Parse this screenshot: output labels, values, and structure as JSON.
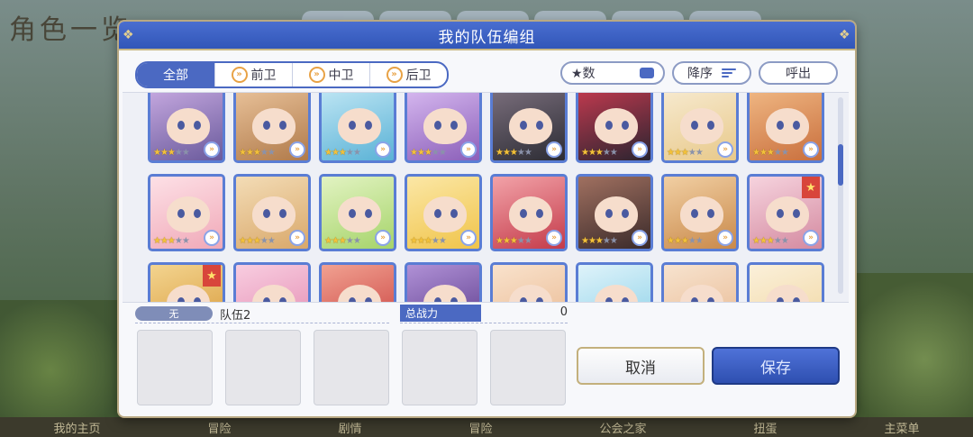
{
  "background": {
    "title": "角色一览",
    "nav": [
      "我的主页",
      "冒险",
      "剧情",
      "冒险",
      "公会之家",
      "扭蛋",
      "主菜单"
    ]
  },
  "dialog": {
    "title": "我的队伍编组",
    "filters": {
      "tabs": [
        {
          "label": "全部",
          "icon": "",
          "active": true
        },
        {
          "label": "前卫",
          "icon": "position-front-icon",
          "active": false
        },
        {
          "label": "中卫",
          "icon": "position-middle-icon",
          "active": false
        },
        {
          "label": "后卫",
          "icon": "position-back-icon",
          "active": false
        }
      ],
      "sort_label": "★数",
      "order_label": "降序",
      "call_label": "呼出"
    },
    "characters": [
      {
        "stars": 3,
        "rank_badge": false
      },
      {
        "stars": 3,
        "rank_badge": false
      },
      {
        "stars": 3,
        "rank_badge": false
      },
      {
        "stars": 3,
        "rank_badge": false
      },
      {
        "stars": 3,
        "rank_badge": false
      },
      {
        "stars": 3,
        "rank_badge": false
      },
      {
        "stars": 3,
        "rank_badge": false
      },
      {
        "stars": 3,
        "rank_badge": false
      },
      {
        "stars": 3,
        "rank_badge": false
      },
      {
        "stars": 3,
        "rank_badge": false
      },
      {
        "stars": 3,
        "rank_badge": false
      },
      {
        "stars": 3,
        "rank_badge": false
      },
      {
        "stars": 3,
        "rank_badge": false
      },
      {
        "stars": 3,
        "rank_badge": false
      },
      {
        "stars": 3,
        "rank_badge": false
      },
      {
        "stars": 3,
        "rank_badge": true
      },
      {
        "stars": 0,
        "rank_badge": true
      },
      {
        "stars": 0,
        "rank_badge": false
      },
      {
        "stars": 0,
        "rank_badge": false
      },
      {
        "stars": 0,
        "rank_badge": false
      },
      {
        "stars": 0,
        "rank_badge": false
      },
      {
        "stars": 0,
        "rank_badge": false
      },
      {
        "stars": 0,
        "rank_badge": false
      },
      {
        "stars": 0,
        "rank_badge": false
      }
    ],
    "team": {
      "badge": "无",
      "name": "队伍2",
      "power_label": "总战力",
      "power_value": "0"
    },
    "buttons": {
      "cancel": "取消",
      "save": "保存"
    },
    "scroll_position": 0.3
  },
  "colors": {
    "accent": "#4b69c2",
    "header": "#3156b8",
    "gold": "#c3b07c"
  }
}
